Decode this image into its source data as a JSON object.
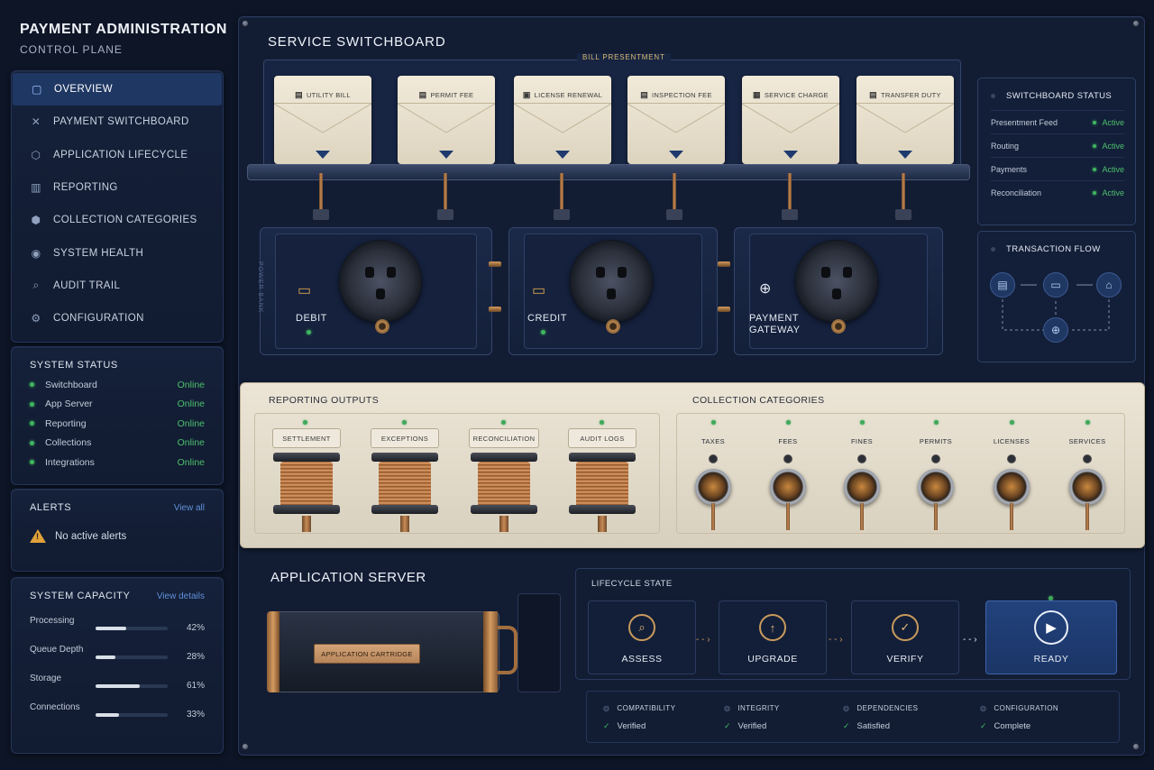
{
  "brand": {
    "title": "PAYMENT ADMINISTRATION",
    "subtitle": "CONTROL PLANE"
  },
  "nav": {
    "items": [
      {
        "label": "OVERVIEW",
        "icon": "overview-icon"
      },
      {
        "label": "PAYMENT SWITCHBOARD",
        "icon": "switchboard-icon"
      },
      {
        "label": "APPLICATION LIFECYCLE",
        "icon": "lifecycle-icon"
      },
      {
        "label": "REPORTING",
        "icon": "chart-icon"
      },
      {
        "label": "COLLECTION CATEGORIES",
        "icon": "categories-icon"
      },
      {
        "label": "SYSTEM HEALTH",
        "icon": "health-icon"
      },
      {
        "label": "AUDIT TRAIL",
        "icon": "audit-icon"
      },
      {
        "label": "CONFIGURATION",
        "icon": "gear-icon"
      }
    ]
  },
  "system_status": {
    "title": "SYSTEM STATUS",
    "items": [
      {
        "label": "Switchboard",
        "value": "Online"
      },
      {
        "label": "App Server",
        "value": "Online"
      },
      {
        "label": "Reporting",
        "value": "Online"
      },
      {
        "label": "Collections",
        "value": "Online"
      },
      {
        "label": "Integrations",
        "value": "Online"
      }
    ]
  },
  "alerts": {
    "title": "ALERTS",
    "link": "View all",
    "message": "No active alerts"
  },
  "capacity": {
    "title": "SYSTEM CAPACITY",
    "link": "View details",
    "items": [
      {
        "label": "Processing",
        "value": 42,
        "display": "42%"
      },
      {
        "label": "Queue Depth",
        "value": 28,
        "display": "28%"
      },
      {
        "label": "Storage",
        "value": 61,
        "display": "61%"
      },
      {
        "label": "Connections",
        "value": 33,
        "display": "33%"
      }
    ]
  },
  "switchboard": {
    "title": "SERVICE SWITCHBOARD",
    "bill_label": "BILL PRESENTMENT",
    "side_label": "POWER BANK",
    "bills": [
      "UTILITY BILL",
      "PERMIT FEE",
      "LICENSE RENEWAL",
      "INSPECTION FEE",
      "SERVICE CHARGE",
      "TRANSFER DUTY"
    ],
    "jacks": [
      {
        "line1": "DEBIT",
        "line2": "",
        "icon": "debit-card-icon"
      },
      {
        "line1": "CREDIT",
        "line2": "",
        "icon": "credit-card-icon"
      },
      {
        "line1": "PAYMENT",
        "line2": "GATEWAY",
        "icon": "globe-icon"
      }
    ]
  },
  "switchboard_status": {
    "title": "SWITCHBOARD STATUS",
    "items": [
      {
        "label": "Presentment Feed",
        "value": "Active"
      },
      {
        "label": "Routing",
        "value": "Active"
      },
      {
        "label": "Payments",
        "value": "Active"
      },
      {
        "label": "Reconciliation",
        "value": "Active"
      }
    ]
  },
  "transaction_flow": {
    "title": "TRANSACTION FLOW"
  },
  "reporting_outputs": {
    "title": "REPORTING OUTPUTS",
    "items": [
      "SETTLEMENT",
      "EXCEPTIONS",
      "RECONCILIATION",
      "AUDIT LOGS"
    ]
  },
  "collection_categories": {
    "title": "COLLECTION CATEGORIES",
    "items": [
      "TAXES",
      "FEES",
      "FINES",
      "PERMITS",
      "LICENSES",
      "SERVICES"
    ]
  },
  "app_server": {
    "title": "APPLICATION SERVER",
    "cartridge_label": "APPLICATION CARTRIDGE",
    "lifecycle_title": "LIFECYCLE STATE",
    "stages": [
      "ASSESS",
      "UPGRADE",
      "VERIFY",
      "READY"
    ],
    "checks": [
      {
        "label": "COMPATIBILITY",
        "value": "Verified"
      },
      {
        "label": "INTEGRITY",
        "value": "Verified"
      },
      {
        "label": "DEPENDENCIES",
        "value": "Satisfied"
      },
      {
        "label": "CONFIGURATION",
        "value": "Complete"
      }
    ]
  },
  "colors": {
    "accent": "#1f3763",
    "online": "#4cc06b",
    "copper": "#c98a55",
    "beige": "#ece5d6"
  }
}
